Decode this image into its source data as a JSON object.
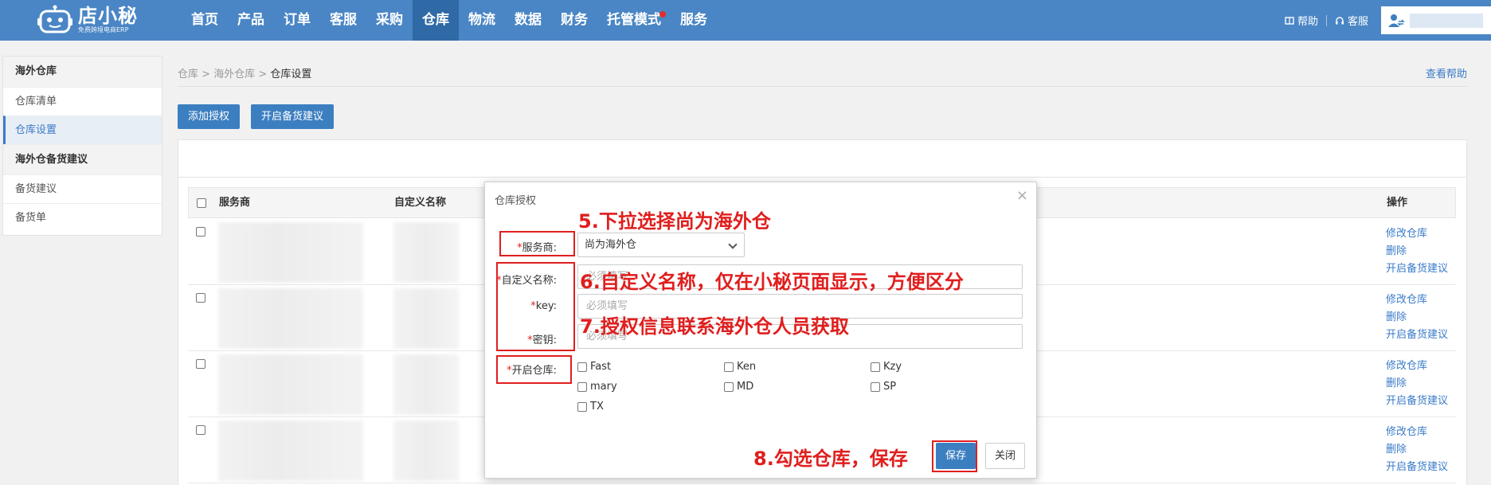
{
  "header": {
    "logo_main": "店小秘",
    "logo_sub": "免费跨境电商ERP",
    "nav": [
      {
        "label": "首页"
      },
      {
        "label": "产品"
      },
      {
        "label": "订单"
      },
      {
        "label": "客服"
      },
      {
        "label": "采购"
      },
      {
        "label": "仓库",
        "active": true
      },
      {
        "label": "物流"
      },
      {
        "label": "数据"
      },
      {
        "label": "财务"
      },
      {
        "label": "托管模式",
        "dot": true
      },
      {
        "label": "服务"
      }
    ],
    "help": "帮助",
    "service": "客服"
  },
  "sidebar": {
    "groups": [
      {
        "title": "海外仓库",
        "items": [
          "仓库清单",
          "仓库设置"
        ]
      },
      {
        "title": "海外仓备货建议",
        "items": [
          "备货建议",
          "备货单"
        ]
      }
    ],
    "active_item": "仓库设置"
  },
  "breadcrumb": {
    "a": "仓库",
    "b": "海外仓库",
    "current": "仓库设置",
    "sep": ">"
  },
  "help_link": "查看帮助",
  "actions": {
    "add_auth": "添加授权",
    "enable_suggest": "开启备货建议"
  },
  "table": {
    "headers": {
      "provider": "服务商",
      "custom_name": "自定义名称",
      "ops": "操作"
    },
    "row_ops": [
      "修改仓库",
      "删除",
      "开启备货建议"
    ],
    "row_count": 4
  },
  "modal": {
    "title": "仓库授权",
    "close": "×",
    "req": "*",
    "fields": {
      "provider_label": "服务商:",
      "provider_value": "尚为海外仓",
      "name_label": "自定义名称:",
      "name_placeholder": "必须填写",
      "key_label": "key:",
      "key_placeholder": "必须填写",
      "secret_label": "密钥:",
      "secret_placeholder": "必须填写",
      "warehouse_label": "开启仓库:"
    },
    "warehouses": [
      "Fast",
      "Ken",
      "Kzy",
      "mary",
      "MD",
      "SP",
      "TX"
    ],
    "save": "保存",
    "cancel": "关闭"
  },
  "annotations": {
    "step5": "5.下拉选择尚为海外仓",
    "step6": "6.自定义名称，仅在小秘页面显示，方便区分",
    "step7": "7.授权信息联系海外仓人员获取",
    "step8": "8.勾选仓库，保存"
  },
  "colors": {
    "header": "#4a86c5",
    "nav_active": "#2f6aa6",
    "primary": "#3c7fc1",
    "link": "#3a7bc8",
    "annotation": "#e01e1e"
  }
}
